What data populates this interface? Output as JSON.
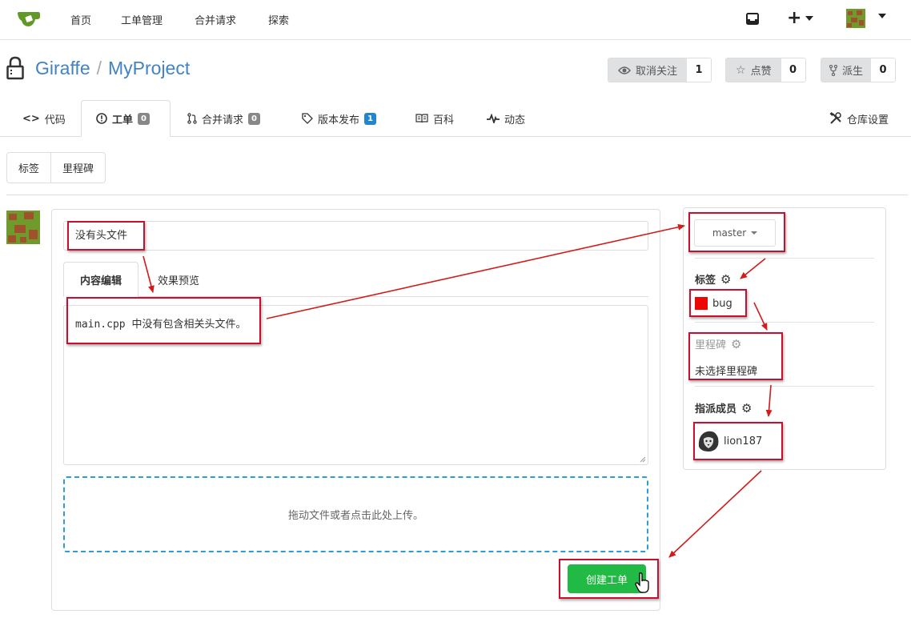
{
  "nav": {
    "items": [
      "首页",
      "工单管理",
      "合并请求",
      "探索"
    ],
    "plus": "+"
  },
  "repo": {
    "owner": "Giraffe",
    "separator": "/",
    "name": "MyProject",
    "watch": {
      "label": "取消关注",
      "count": "1"
    },
    "star": {
      "label": "点赞",
      "count": "0"
    },
    "fork": {
      "label": "派生",
      "count": "0"
    }
  },
  "tabs": {
    "code": "代码",
    "issues": "工单",
    "issues_count": "0",
    "pulls": "合并请求",
    "pulls_count": "0",
    "releases": "版本发布",
    "releases_count": "1",
    "wiki": "百科",
    "activity": "动态",
    "settings": "仓库设置"
  },
  "submenu": {
    "labels": "标签",
    "milestones": "里程碑"
  },
  "form": {
    "title_value": "没有头文件",
    "tab_write": "内容编辑",
    "tab_preview": "效果预览",
    "content_value": "main.cpp 中没有包含相关头文件。",
    "dropzone_text": "拖动文件或者点击此处上传。",
    "submit": "创建工单"
  },
  "sidebar": {
    "branch": "master",
    "labels_heading": "标签",
    "label_name": "bug",
    "label_color": "#ee0701",
    "milestone_heading": "里程碑",
    "milestone_value": "未选择里程碑",
    "assignees_heading": "指派成员",
    "assignee_name": "lion187"
  },
  "colors": {
    "link": "#4183c4",
    "primary_green": "#21ba45",
    "annotation_red": "#c8102e",
    "dropzone_border": "#2e9cd6"
  },
  "icons": [
    "gitea-logo-icon",
    "inbox-icon",
    "plus-icon",
    "lock-icon",
    "eye-icon",
    "star-icon",
    "fork-icon",
    "code-icon",
    "issue-icon",
    "pull-request-icon",
    "tag-icon",
    "book-icon",
    "pulse-icon",
    "tools-icon",
    "gear-icon",
    "pointer-cursor-icon"
  ]
}
